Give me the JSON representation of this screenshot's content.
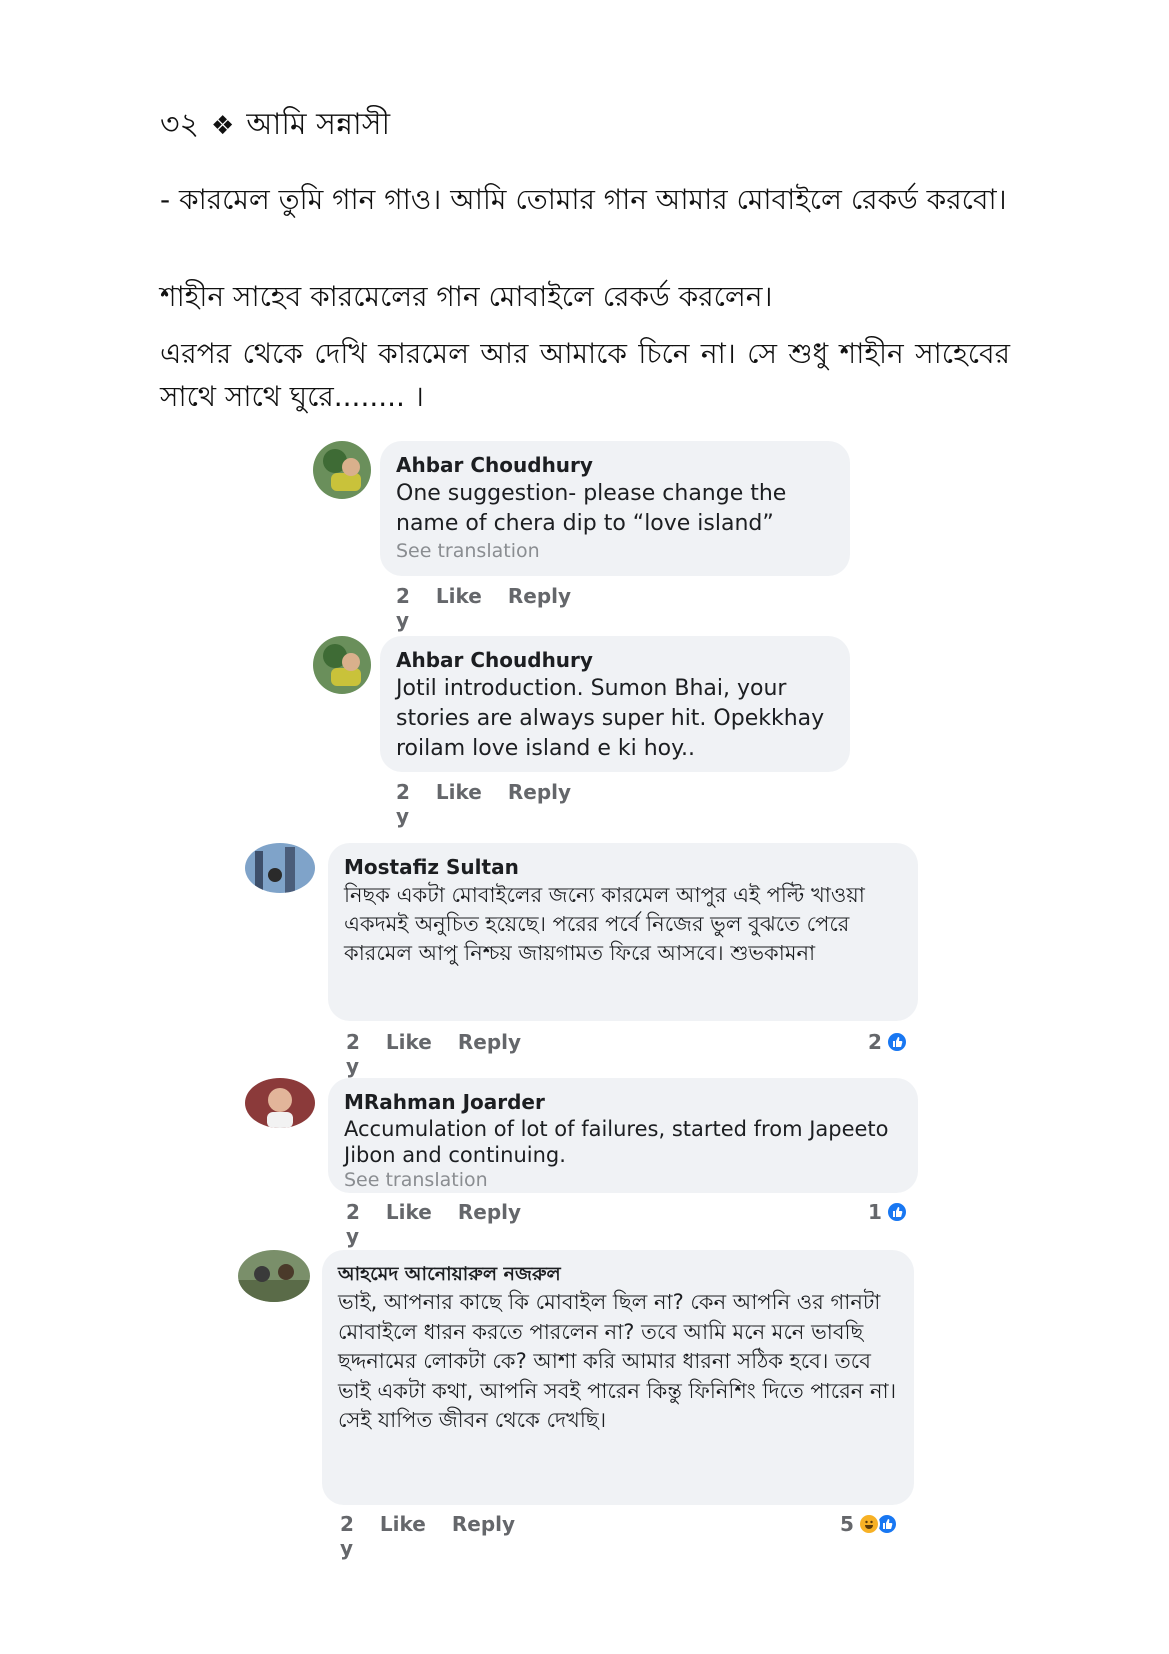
{
  "header": {
    "page_number": "৩২",
    "separator": "❖",
    "title": "আমি সন্নাসী"
  },
  "paragraphs": [
    "- কারমেল তুমি গান গাও। আমি তোমার গান আমার মোবাইলে রেকর্ড করবো।",
    "শাহীন সাহেব কারমেলের গান মোবাইলে রেকর্ড করলেন।",
    "এরপর থেকে দেখি কারমেল আর আমাকে চিনে না। সে শুধু শাহীন সাহেবের সাথে সাথে ঘুরে........ ।"
  ],
  "actions": {
    "time": "2 y",
    "like": "Like",
    "reply": "Reply"
  },
  "comments": [
    {
      "author": "Ahbar Choudhury",
      "text": "One suggestion- please change the name of chera dip to “love island”",
      "see_translation": "See translation"
    },
    {
      "author": "Ahbar Choudhury",
      "text": "Jotil introduction. Sumon  Bhai, your stories are always super hit. Opekkhay roilam love island e ki hoy.."
    },
    {
      "author": "Mostafiz Sultan",
      "text": "নিছক একটা মোবাইলের জন্যে কারমেল আপুর এই পল্টি খাওয়া একদমই অনুচিত হয়েছে। পরের পর্বে নিজের ভুল বুঝতে পেরে কারমেল আপু নিশ্চয় জায়গামত ফিরে আসবে। শুভকামনা",
      "reactions": "2"
    },
    {
      "author": "MRahman Joarder",
      "text": "Accumulation of lot of failures, started from Japeeto Jibon and continuing.",
      "see_translation": "See translation",
      "reactions": "1"
    },
    {
      "author": "আহমেদ আনোয়ারুল নজরুল",
      "text": "ভাই, আপনার কাছে কি মোবাইল  ছিল না? কেন আপনি ওর গানটা মোবাইলে ধারন করতে পারলেন না? তবে আমি মনে মনে ভাবছি ছদ্দনামের লোকটা কে? আশা করি আমার ধারনা সঠিক হবে। তবে ভাই একটা কথা, আপনি সবই পারেন কিন্তু ফিনিশিং দিতে পারেন না। সেই যাপিত জীবন থেকে দেখছি।",
      "reactions": "5"
    }
  ],
  "icons": {
    "like": "like-reaction-icon",
    "haha": "haha-reaction-icon"
  },
  "colors": {
    "bubble": "#f0f2f5",
    "like_blue": "#1877f2",
    "haha_yellow": "#f7b125",
    "meta_gray": "#65676b"
  }
}
